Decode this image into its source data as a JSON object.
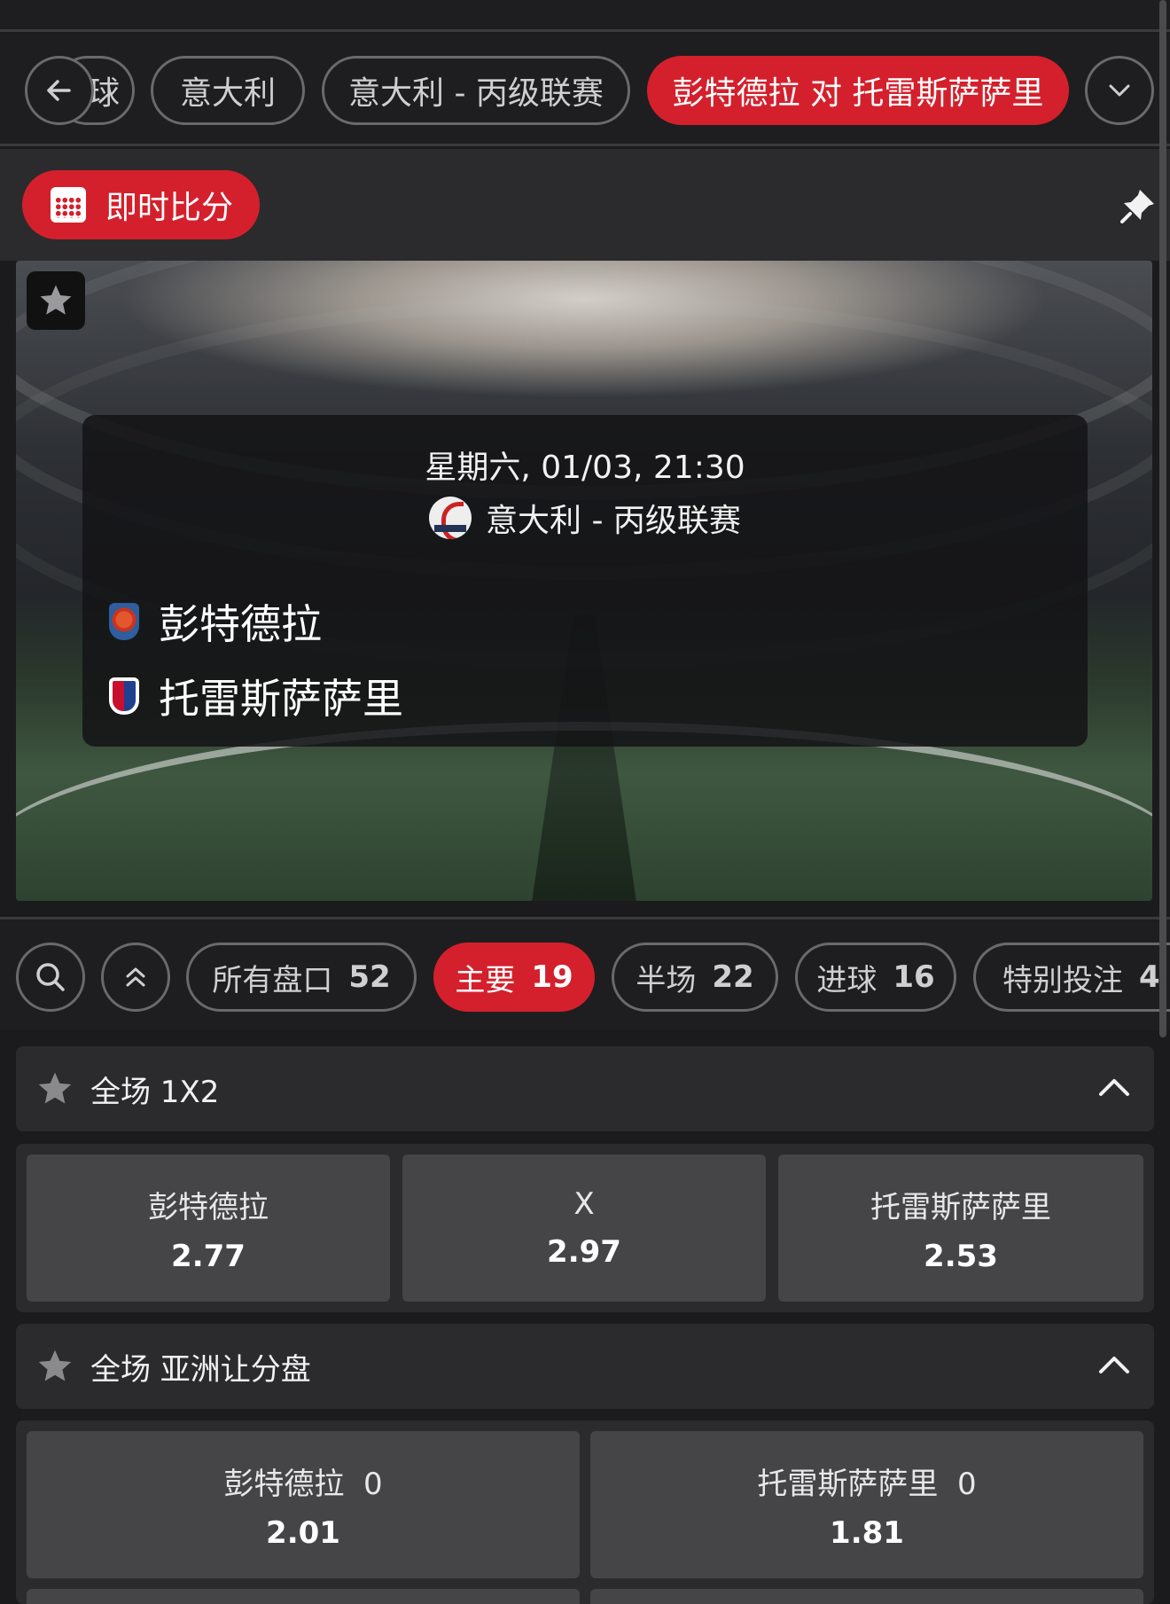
{
  "breadcrumb": {
    "back_partial": "球",
    "items": [
      "意大利",
      "意大利 - 丙级联赛",
      "彭特德拉 对 托雷斯萨萨里"
    ]
  },
  "live_score": {
    "label": "即时比分"
  },
  "match": {
    "datetime": "星期六, 01/03, 21:30",
    "league": "意大利 - 丙级联赛",
    "home_team": "彭特德拉",
    "away_team": "托雷斯萨萨里"
  },
  "market_tabs": [
    {
      "label": "所有盘口",
      "count": "52"
    },
    {
      "label": "主要",
      "count": "19"
    },
    {
      "label": "半场",
      "count": "22"
    },
    {
      "label": "进球",
      "count": "16"
    },
    {
      "label": "特别投注",
      "count": "4"
    }
  ],
  "markets": {
    "fulltime_1x2": {
      "title": "全场 1X2",
      "selections": [
        {
          "name": "彭特德拉",
          "price": "2.77"
        },
        {
          "name": "X",
          "price": "2.97"
        },
        {
          "name": "托雷斯萨萨里",
          "price": "2.53"
        }
      ]
    },
    "asian_handicap": {
      "title": "全场 亚洲让分盘",
      "selections": [
        {
          "name": "彭特德拉  0",
          "price": "2.01"
        },
        {
          "name": "托雷斯萨萨里  0",
          "price": "1.81"
        }
      ]
    }
  },
  "colors": {
    "accent": "#d4202c",
    "background": "#1e1e20",
    "panel": "#2b2b2d",
    "odd_button": "#454547"
  }
}
